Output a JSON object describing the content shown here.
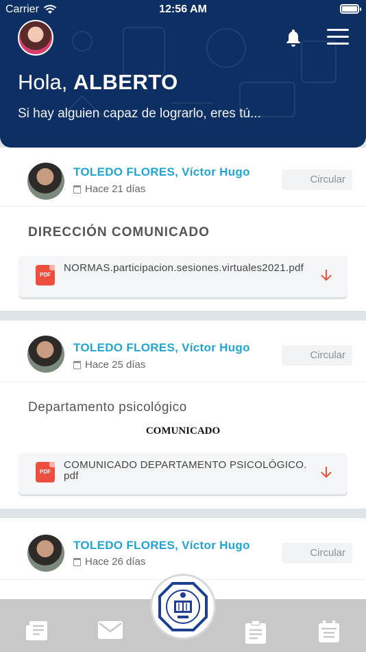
{
  "status_bar": {
    "carrier": "Carrier",
    "time": "12:56 AM"
  },
  "header": {
    "greeting": "Hola,",
    "user_name": "ALBERTO",
    "motto": "Si hay alguien capaz de lograrlo, eres tú...",
    "bg_color": "#0d2f63"
  },
  "posts": [
    {
      "author": "TOLEDO FLORES, Víctor Hugo",
      "date": "Hace 21 días",
      "action": "Circular",
      "title": "DIRECCIÓN COMUNICADO",
      "attachment": "NORMAS.participacion.sesiones.virtuales2021.pdf"
    },
    {
      "author": "TOLEDO FLORES, Víctor Hugo",
      "date": "Hace 25 días",
      "action": "Circular",
      "title": "Departamento psicológico",
      "subtitle": "COMUNICADO",
      "attachment": "COMUNICADO DEPARTAMENTO PSICOLÓGICO.pdf"
    },
    {
      "author": "TOLEDO FLORES, Víctor Hugo",
      "date": "Hace 26 días",
      "action": "Circular"
    }
  ],
  "pdf_badge": "PDF",
  "icons": [
    "wifi-icon",
    "battery-icon",
    "bell-icon",
    "hamburger-menu-icon",
    "calendar-icon",
    "pdf-icon",
    "download-arrow-icon",
    "news-feed-icon",
    "mail-icon",
    "school-logo",
    "clipboard-icon",
    "calendar-tab-icon"
  ],
  "colors": {
    "accent": "#1fa5d4",
    "pdf": "#ec4f3d",
    "tabbar": "#c8c8c8"
  }
}
